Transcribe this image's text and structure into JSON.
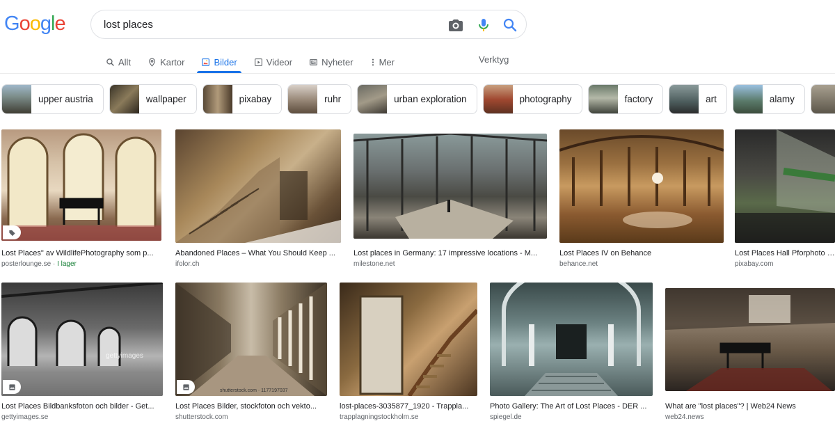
{
  "header": {
    "logo": [
      "G",
      "o",
      "o",
      "g",
      "l",
      "e"
    ],
    "logo_colors": [
      "#4285f4",
      "#ea4335",
      "#fbbc05",
      "#4285f4",
      "#34a853",
      "#ea4335"
    ],
    "search_query": "lost places"
  },
  "tabs": [
    {
      "label": "Allt",
      "icon": "search-icon"
    },
    {
      "label": "Kartor",
      "icon": "map-pin-icon"
    },
    {
      "label": "Bilder",
      "icon": "image-icon",
      "active": true
    },
    {
      "label": "Videor",
      "icon": "play-icon"
    },
    {
      "label": "Nyheter",
      "icon": "newspaper-icon"
    },
    {
      "label": "Mer",
      "icon": "more-vert-icon"
    }
  ],
  "tools_label": "Verktyg",
  "chips": [
    "upper austria",
    "wallpaper",
    "pixabay",
    "ruhr",
    "urban exploration",
    "photography",
    "factory",
    "art",
    "alamy"
  ],
  "results": [
    {
      "title": "Lost Places\" av WildlifePhotography som p...",
      "source": "posterlounge.se",
      "extra": "I lager"
    },
    {
      "title": "Abandoned Places – What You Should Keep ...",
      "source": "ifolor.ch"
    },
    {
      "title": "Lost places in Germany: 17 impressive locations - M...",
      "source": "milestone.net"
    },
    {
      "title": "Lost Places IV on Behance",
      "source": "behance.net"
    },
    {
      "title": "Lost Places Hall Pforphoto - ...",
      "source": "pixabay.com"
    },
    {
      "title": "Lost Places Bildbanksfoton och bilder - Get...",
      "source": "gettyimages.se"
    },
    {
      "title": "Lost Places Bilder, stockfoton och vekto...",
      "source": "shutterstock.com"
    },
    {
      "title": "lost-places-3035877_1920 - Trappla...",
      "source": "trapplagningstockholm.se"
    },
    {
      "title": "Photo Gallery: The Art of Lost Places - DER ...",
      "source": "spiegel.de"
    },
    {
      "title": "What are \"lost places\"? | Web24 News",
      "source": "web24.news"
    }
  ],
  "watermarks": {
    "getty": "gettyimages",
    "shutterstock": "shutterstock.com · 1177197037"
  }
}
